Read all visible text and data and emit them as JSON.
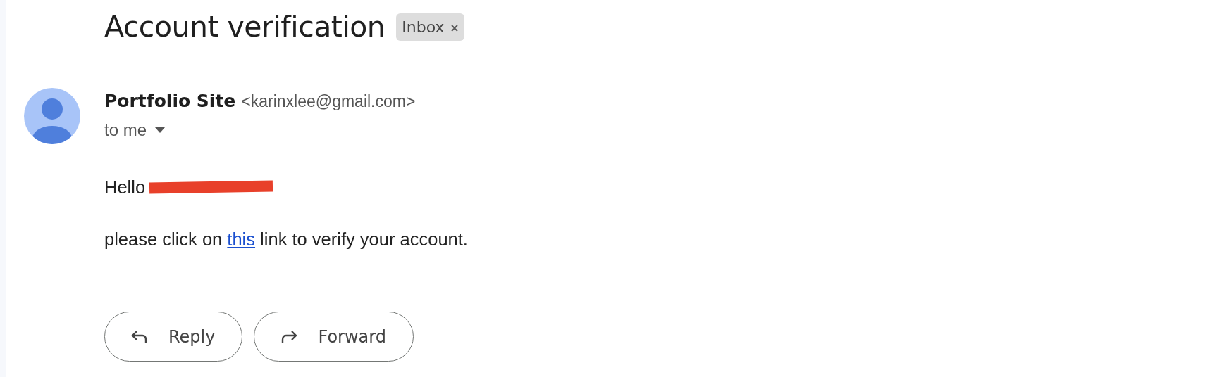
{
  "subject": "Account verification",
  "labels": [
    {
      "text": "Inbox",
      "removable": true
    }
  ],
  "sender": {
    "name": "Portfolio Site",
    "email": "<karinxlee@gmail.com>"
  },
  "recipient": {
    "text": "to me",
    "expanded": false
  },
  "body": {
    "greeting": "Hello",
    "greeting_redacted": true,
    "paragraph": {
      "before": "please click on ",
      "link": "this",
      "after": " link to verify your account."
    }
  },
  "actions": [
    {
      "kind": "reply",
      "label": "Reply"
    },
    {
      "kind": "forward",
      "label": "Forward"
    }
  ]
}
